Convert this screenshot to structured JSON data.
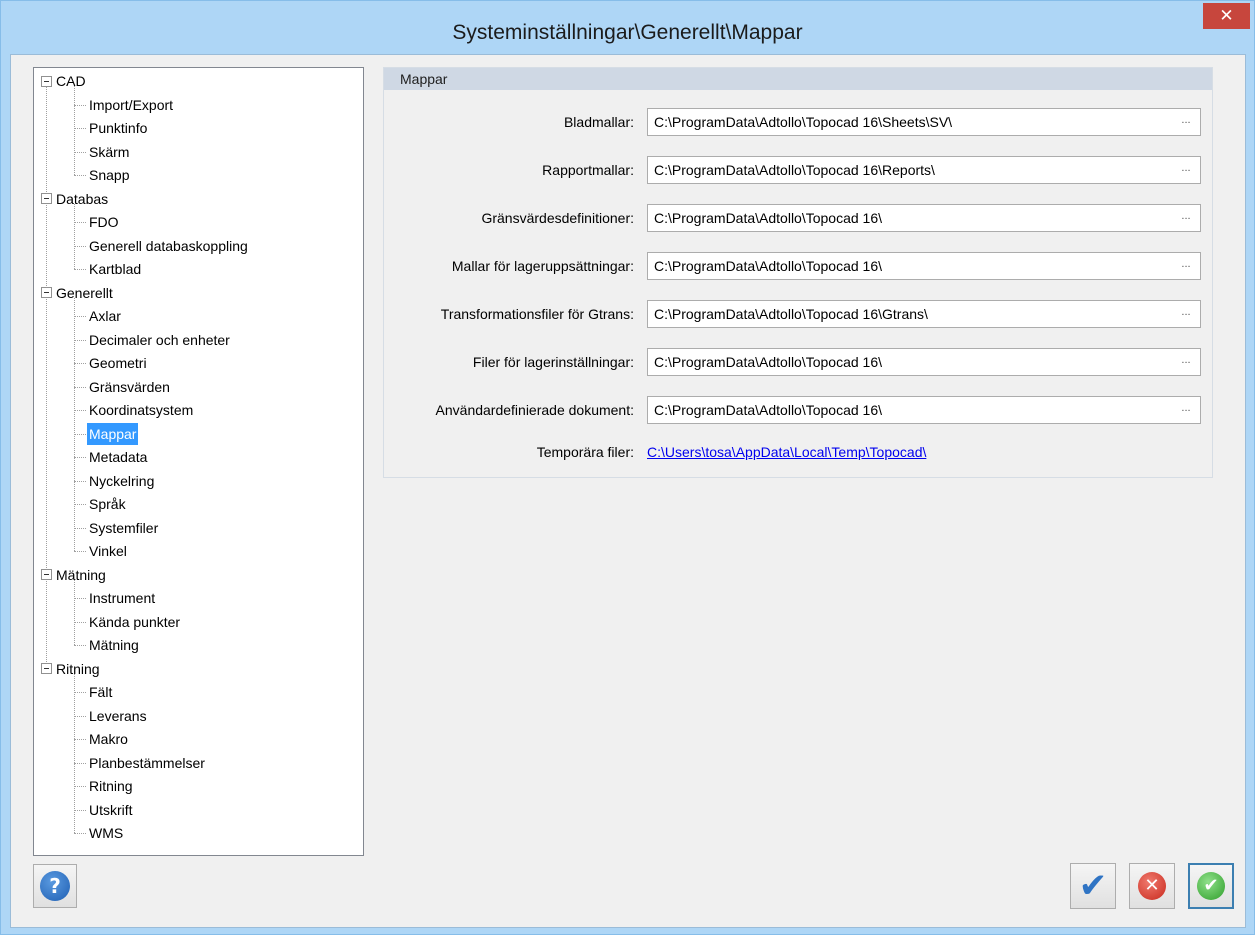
{
  "window": {
    "title": "Systeminställningar\\Generellt\\Mappar",
    "close_label": "✕"
  },
  "tree": {
    "groups": [
      {
        "label": "CAD",
        "children": [
          "Import/Export",
          "Punktinfo",
          "Skärm",
          "Snapp"
        ]
      },
      {
        "label": "Databas",
        "children": [
          "FDO",
          "Generell databaskoppling",
          "Kartblad"
        ]
      },
      {
        "label": "Generellt",
        "children": [
          "Axlar",
          "Decimaler och enheter",
          "Geometri",
          "Gränsvärden",
          "Koordinatsystem",
          "Mappar",
          "Metadata",
          "Nyckelring",
          "Språk",
          "Systemfiler",
          "Vinkel"
        ]
      },
      {
        "label": "Mätning",
        "children": [
          "Instrument",
          "Kända punkter",
          "Mätning"
        ]
      },
      {
        "label": "Ritning",
        "children": [
          "Fält",
          "Leverans",
          "Makro",
          "Planbestämmelser",
          "Ritning",
          "Utskrift",
          "WMS"
        ]
      }
    ],
    "selected": "Mappar"
  },
  "panel": {
    "header": "Mappar",
    "rows": [
      {
        "label": "Bladmallar:",
        "value": "C:\\ProgramData\\Adtollo\\Topocad 16\\Sheets\\SV\\",
        "browse": "..."
      },
      {
        "label": "Rapportmallar:",
        "value": "C:\\ProgramData\\Adtollo\\Topocad 16\\Reports\\",
        "browse": "..."
      },
      {
        "label": "Gränsvärdesdefinitioner:",
        "value": "C:\\ProgramData\\Adtollo\\Topocad 16\\",
        "browse": "..."
      },
      {
        "label": "Mallar för lageruppsättningar:",
        "value": "C:\\ProgramData\\Adtollo\\Topocad 16\\",
        "browse": "..."
      },
      {
        "label": "Transformationsfiler för Gtrans:",
        "value": "C:\\ProgramData\\Adtollo\\Topocad 16\\Gtrans\\",
        "browse": "..."
      },
      {
        "label": "Filer för lagerinställningar:",
        "value": "C:\\ProgramData\\Adtollo\\Topocad 16\\",
        "browse": "..."
      },
      {
        "label": "Användardefinierade dokument:",
        "value": "C:\\ProgramData\\Adtollo\\Topocad 16\\",
        "browse": "..."
      }
    ],
    "temp_label": "Temporära filer:",
    "temp_link": "C:\\Users\\tosa\\AppData\\Local\\Temp\\Topocad\\"
  },
  "buttons": {
    "help": "?",
    "apply": "✔",
    "cancel": "✕",
    "ok": "✔"
  }
}
